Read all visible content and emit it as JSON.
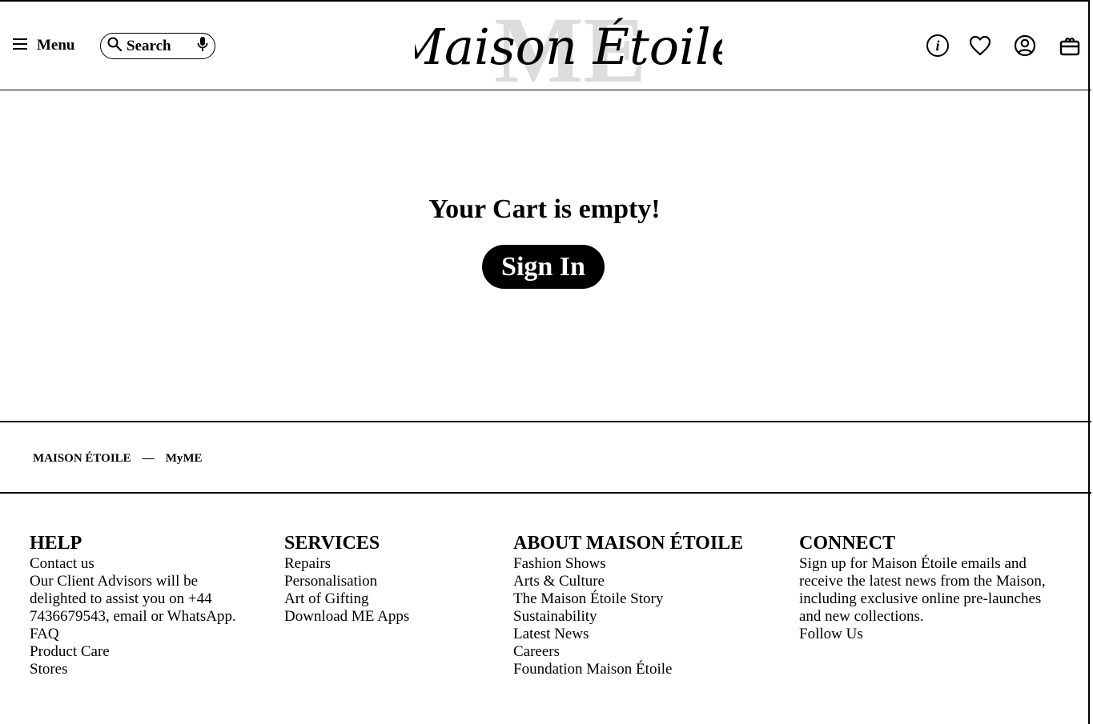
{
  "header": {
    "menu_label": "Menu",
    "search_label": "Search",
    "logo_text": "Maison Étoile",
    "logo_monogram": "ME",
    "icons": [
      "info-icon",
      "heart-icon",
      "account-icon",
      "bag-icon"
    ]
  },
  "main": {
    "title": "Your Cart is empty!",
    "signin_label": "Sign In"
  },
  "breadcrumb": {
    "brand": "MAISON ÉTOILE",
    "separator": "—",
    "current": "MyME"
  },
  "footer": {
    "help": {
      "title": "HELP",
      "contact": "Contact us",
      "advisors_text": "Our Client Advisors will be delighted to assist you on +44 7436679543, email or WhatsApp.",
      "faq": "FAQ",
      "product_care": "Product Care",
      "stores": "Stores"
    },
    "services": {
      "title": "SERVICES",
      "links": [
        "Repairs",
        "Personalisation",
        "Art of Gifting",
        "Download ME Apps"
      ]
    },
    "about": {
      "title": "ABOUT MAISON ÉTOILE",
      "links": [
        "Fashion Shows",
        "Arts & Culture",
        "The Maison Étoile Story",
        "Sustainability",
        "Latest News",
        "Careers",
        "Foundation Maison Étoile"
      ]
    },
    "connect": {
      "title": "CONNECT",
      "text": "Sign up for Maison Étoile emails and receive the latest news from the Maison, including exclusive online pre-launches and new collections.",
      "follow": "Follow Us"
    }
  }
}
